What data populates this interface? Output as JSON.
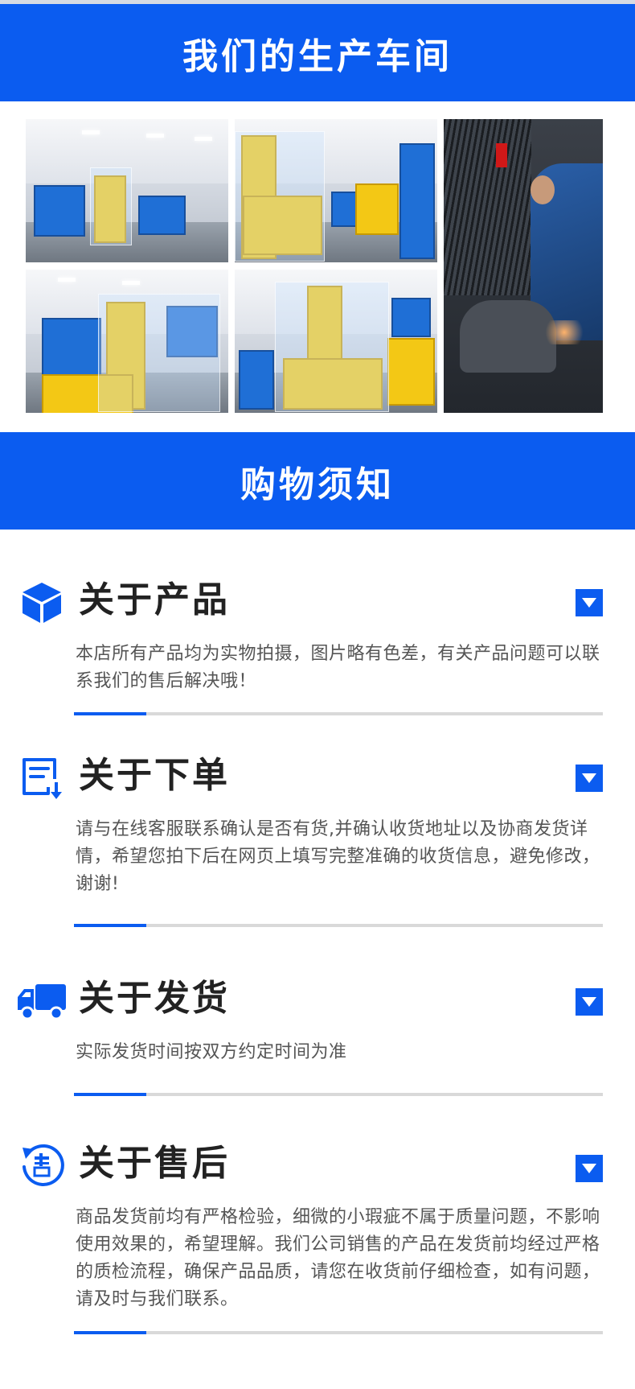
{
  "workshop": {
    "title": "我们的生产车间"
  },
  "notice": {
    "title": "购物须知"
  },
  "sections": [
    {
      "title": "关于产品",
      "text": "本店所有产品均为实物拍摄，图片略有色差，有关产品问题可以联系我们的售后解决哦！",
      "icon": "cube-icon"
    },
    {
      "title": "关于下单",
      "text": "请与在线客服联系确认是否有货,并确认收货地址以及协商发货详情，希望您拍下后在网页上填写完整准确的收货信息，避免修改，谢谢!",
      "icon": "order-list-icon"
    },
    {
      "title": "关于发货",
      "text": "实际发货时间按双方约定时间为准",
      "icon": "truck-icon"
    },
    {
      "title": "关于售后",
      "text": "商品发货前均有严格检验，细微的小瑕疵不属于质量问题，不影响使用效果的，希望理解。我们公司销售的产品在发货前均经过严格的质检流程，确保产品品质，请您在收货前仔细检查，如有问题，请及时与我们联系。",
      "icon": "after-sale-icon"
    }
  ],
  "colors": {
    "accent": "#0b5cf0",
    "text": "#555555",
    "title": "#222222"
  }
}
